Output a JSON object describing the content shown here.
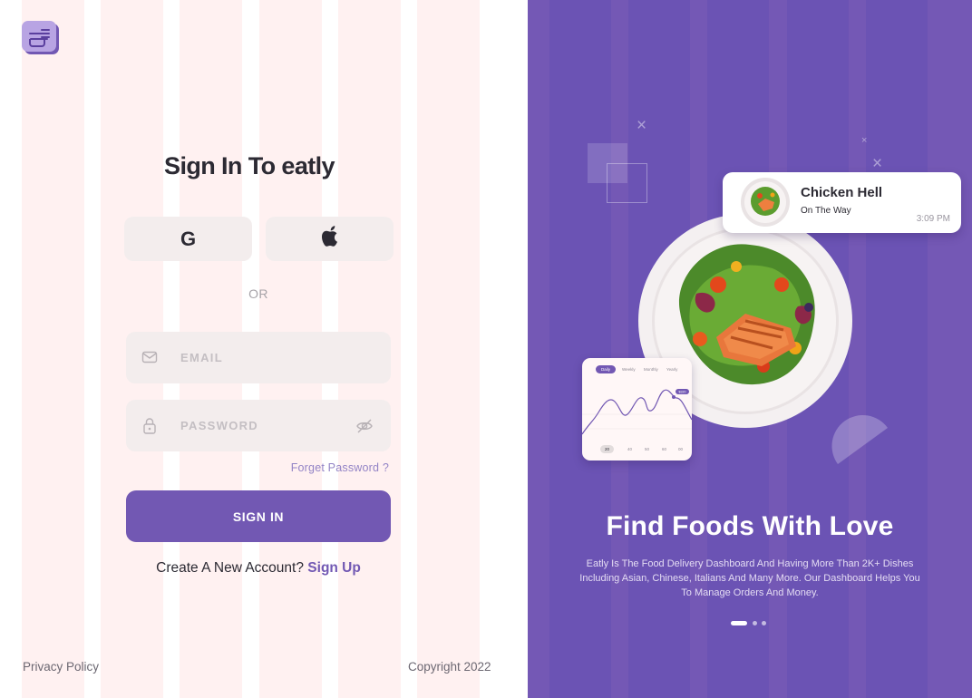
{
  "brand": {
    "logo_icon": "eatly-logo-icon",
    "accent": "#7258b3",
    "panel_bg": "#7458b5",
    "stripe": "#fff1f1"
  },
  "signin": {
    "title": "Sign In To eatly",
    "google_label": "G",
    "google_icon": "google-icon",
    "apple_icon": "apple-icon",
    "or_label": "OR",
    "email_placeholder": "EMAIL",
    "password_placeholder": "PASSWORD",
    "forgot_label": "Forget Password ?",
    "submit_label": "SIGN IN",
    "create_prompt": "Create A New Account?",
    "signup_label": "Sign Up"
  },
  "footer": {
    "privacy": "Privacy Policy",
    "copyright": "Copyright 2022"
  },
  "promo": {
    "order": {
      "name": "Chicken Hell",
      "status": "On The Way",
      "time": "3:09 PM"
    },
    "chart": {
      "tabs": [
        "Daily",
        "Weekly",
        "Monthly",
        "Yearly"
      ],
      "active_tab": 0,
      "ticks": [
        "20",
        "40",
        "50",
        "60",
        "00"
      ],
      "active_tick": 0,
      "badge": "$320"
    },
    "title": "Find Foods With Love",
    "description": "Eatly Is The Food Delivery Dashboard And Having More Than 2K+ Dishes Including Asian, Chinese, Italians And Many More. Our Dashboard Helps You To Manage Orders And Money.",
    "slides_total": 3,
    "slide_active": 1
  }
}
